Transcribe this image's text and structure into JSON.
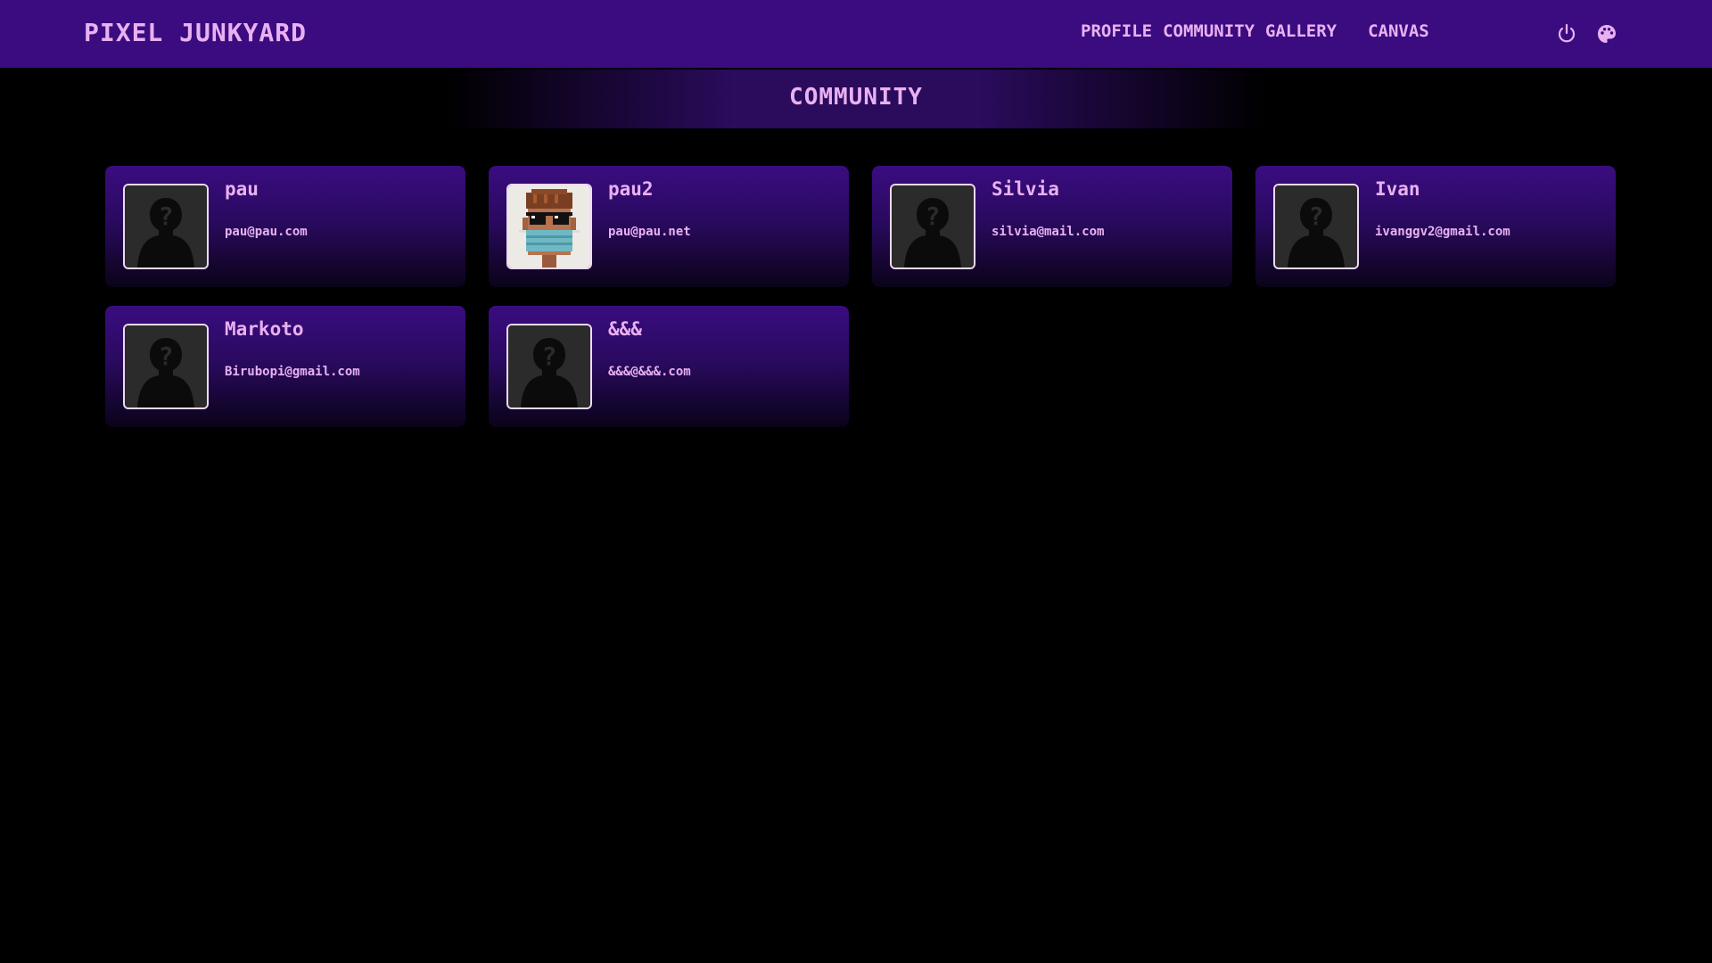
{
  "app": {
    "title": "PIXEL JUNKYARD"
  },
  "nav": {
    "profile": "PROFILE",
    "community": "COMMUNITY",
    "gallery": "GALLERY",
    "canvas": "CANVAS",
    "icons": [
      "power-icon",
      "palette-icon"
    ]
  },
  "page": {
    "title": "COMMUNITY"
  },
  "users": [
    {
      "name": "pau",
      "email": "pau@pau.com",
      "avatar": "placeholder-silhouette"
    },
    {
      "name": "pau2",
      "email": "pau@pau.net",
      "avatar": "pixel-face-sunglasses-mask"
    },
    {
      "name": "Silvia",
      "email": "silvia@mail.com",
      "avatar": "placeholder-silhouette"
    },
    {
      "name": "Ivan",
      "email": "ivanggv2@gmail.com",
      "avatar": "placeholder-silhouette"
    },
    {
      "name": "Markoto",
      "email": "Birubopi@gmail.com",
      "avatar": "placeholder-silhouette"
    },
    {
      "name": "&&&",
      "email": "&&&@&&&.com",
      "avatar": "placeholder-silhouette"
    }
  ],
  "colors": {
    "navbar": "#3a0c80",
    "accent_text": "#e9b1f1",
    "background": "#000000",
    "card_top": "#3a0c80",
    "card_bottom": "#0a0318"
  }
}
